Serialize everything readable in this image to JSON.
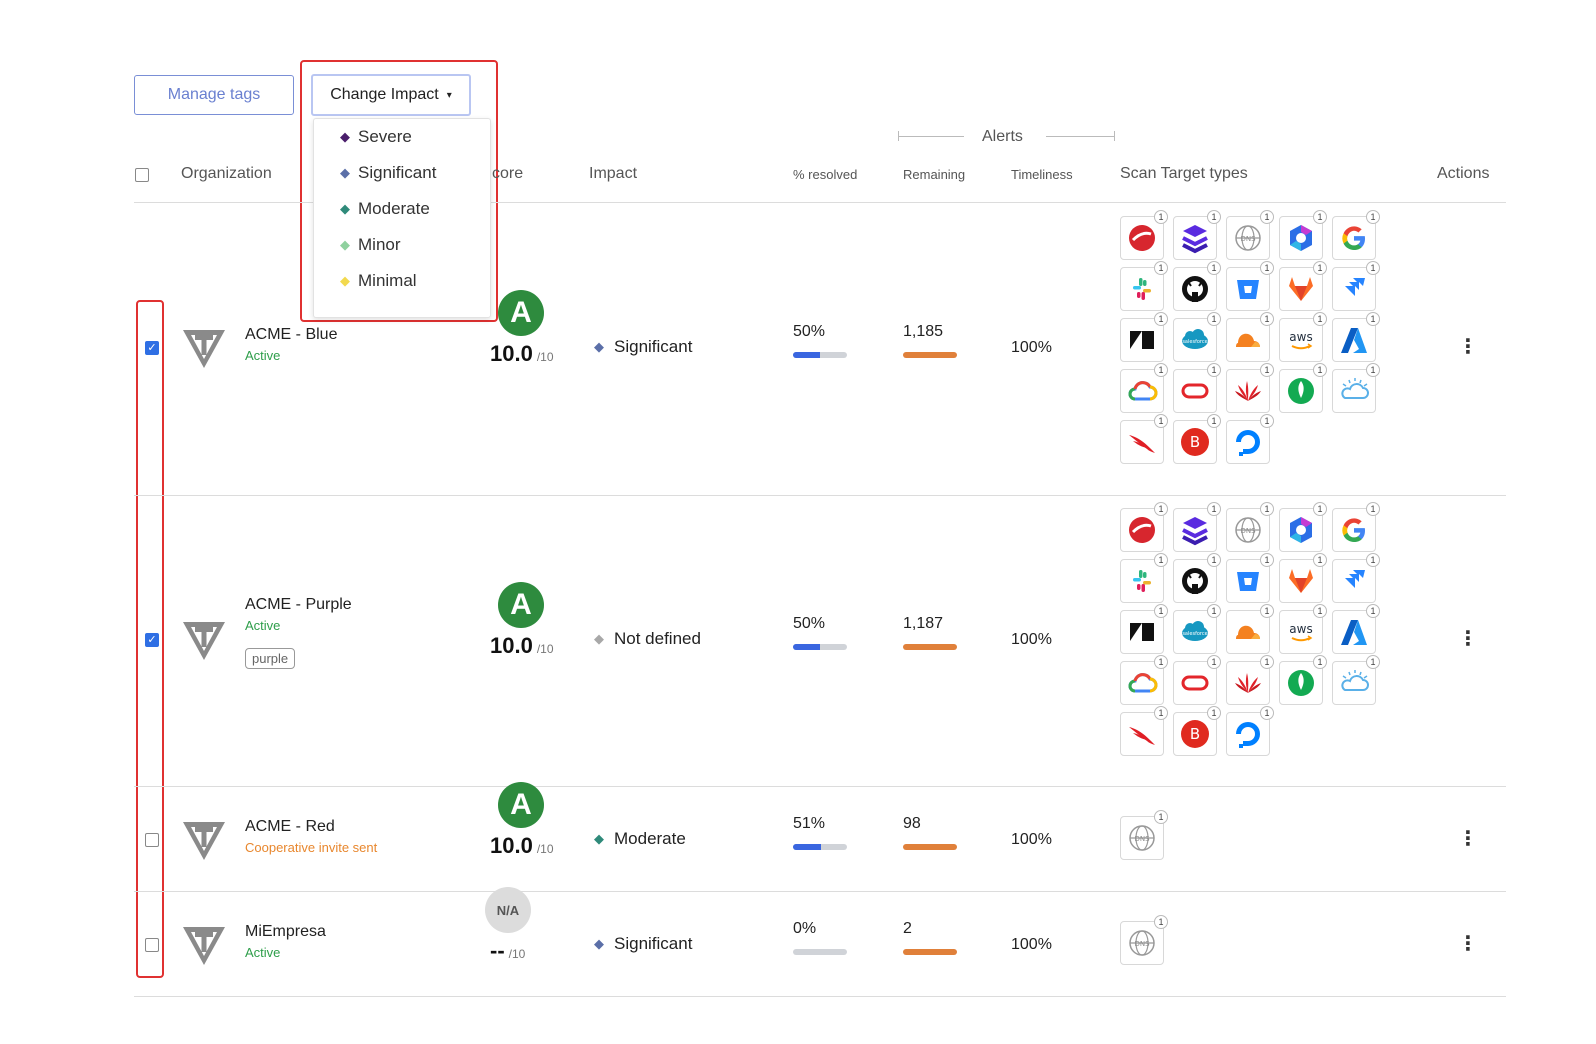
{
  "toolbar": {
    "manage_tags_label": "Manage tags",
    "change_impact_label": "Change Impact",
    "caret": "▾"
  },
  "impact_menu": {
    "items": [
      {
        "label": "Severe",
        "color": "#4a1e6b"
      },
      {
        "label": "Significant",
        "color": "#5b6fa8"
      },
      {
        "label": "Moderate",
        "color": "#2f8a7a"
      },
      {
        "label": "Minor",
        "color": "#8fd19e"
      },
      {
        "label": "Minimal",
        "color": "#f2d94e"
      }
    ]
  },
  "table": {
    "headers": {
      "organization": "Organization",
      "score": "core",
      "impact": "Impact",
      "alerts": "Alerts",
      "resolved": "% resolved",
      "remaining": "Remaining",
      "timeliness": "Timeliness",
      "scan_targets": "Scan Target types",
      "actions": "Actions"
    },
    "rows": [
      {
        "name": "ACME - Blue",
        "status": "Active",
        "status_color": "#2e9e4a",
        "tag": "",
        "grade": "A",
        "score": "10.0",
        "score_den": "/10",
        "impact": "Significant",
        "impact_color": "#5b6fa8",
        "resolved": "50%",
        "resolved_fraction": 0.5,
        "remaining": "1,185",
        "timeliness": "100%",
        "checked": true,
        "icon_set": "full"
      },
      {
        "name": "ACME - Purple",
        "status": "Active",
        "status_color": "#2e9e4a",
        "tag": "purple",
        "grade": "A",
        "score": "10.0",
        "score_den": "/10",
        "impact": "Not defined",
        "impact_color": "#a8a8a8",
        "resolved": "50%",
        "resolved_fraction": 0.5,
        "remaining": "1,187",
        "timeliness": "100%",
        "checked": true,
        "icon_set": "full"
      },
      {
        "name": "ACME - Red",
        "status": "Cooperative invite sent",
        "status_color": "#e8872e",
        "tag": "",
        "grade": "A",
        "score": "10.0",
        "score_den": "/10",
        "impact": "Moderate",
        "impact_color": "#2f8a7a",
        "resolved": "51%",
        "resolved_fraction": 0.51,
        "remaining": "98",
        "timeliness": "100%",
        "checked": false,
        "icon_set": "dns"
      },
      {
        "name": "MiEmpresa",
        "status": "Active",
        "status_color": "#2e9e4a",
        "tag": "",
        "grade": "N/A",
        "score": "--",
        "score_den": "/10",
        "impact": "Significant",
        "impact_color": "#5b6fa8",
        "resolved": "0%",
        "resolved_fraction": 0,
        "remaining": "2",
        "timeliness": "100%",
        "checked": false,
        "icon_set": "dns"
      }
    ]
  },
  "scan_target_icons": [
    {
      "name": "trend-micro-icon",
      "count": "1"
    },
    {
      "name": "stack-icon",
      "count": "1"
    },
    {
      "name": "dns-globe-icon",
      "count": "1"
    },
    {
      "name": "microsoft-365-icon",
      "count": "1"
    },
    {
      "name": "google-icon",
      "count": "1"
    },
    {
      "name": "slack-icon",
      "count": "1"
    },
    {
      "name": "github-icon",
      "count": "1"
    },
    {
      "name": "bitbucket-icon",
      "count": "1"
    },
    {
      "name": "gitlab-icon",
      "count": "1"
    },
    {
      "name": "jira-icon",
      "count": "1"
    },
    {
      "name": "zendesk-icon",
      "count": "1"
    },
    {
      "name": "salesforce-icon",
      "count": "1"
    },
    {
      "name": "cloudflare-icon",
      "count": "1"
    },
    {
      "name": "aws-icon",
      "count": "1",
      "text": "aws"
    },
    {
      "name": "azure-icon",
      "count": "1"
    },
    {
      "name": "google-cloud-icon",
      "count": "1"
    },
    {
      "name": "oracle-icon",
      "count": "1"
    },
    {
      "name": "huawei-icon",
      "count": "1"
    },
    {
      "name": "mongodb-icon",
      "count": "1"
    },
    {
      "name": "ibm-cloud-icon",
      "count": "1"
    },
    {
      "name": "crowdstrike-icon",
      "count": "1"
    },
    {
      "name": "b-icon",
      "count": "1",
      "text": "B"
    },
    {
      "name": "digitalocean-icon",
      "count": "1"
    }
  ]
}
